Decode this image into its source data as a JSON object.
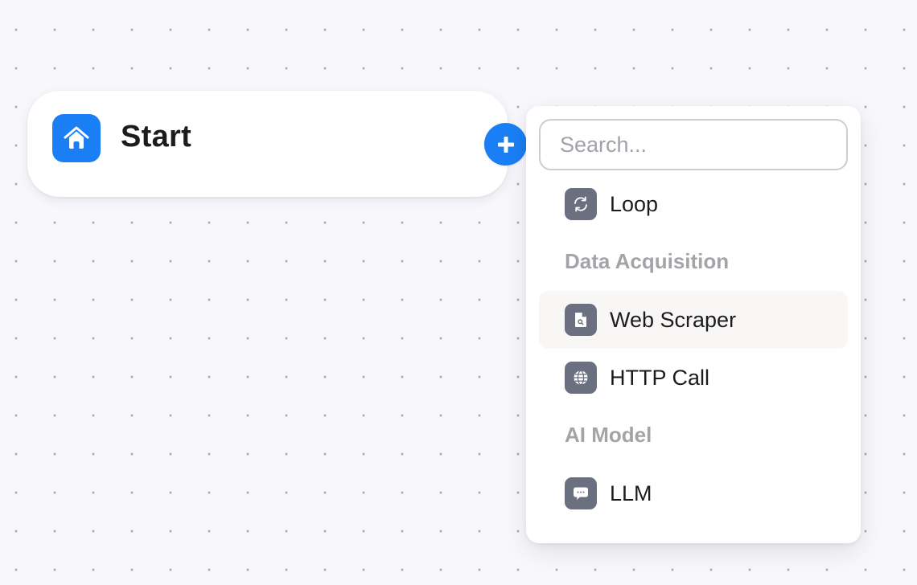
{
  "canvas": {
    "background": "#f8f8fc",
    "dot_color": "#a9a9b0"
  },
  "start_node": {
    "title": "Start",
    "icon": "home-icon",
    "accent": "#1a7ef5"
  },
  "add_button": {
    "icon": "plus-icon"
  },
  "menu": {
    "search": {
      "value": "",
      "placeholder": "Search..."
    },
    "items": [
      {
        "type": "item",
        "label": "Loop",
        "icon": "loop-icon"
      },
      {
        "type": "section",
        "label": "Data Acquisition"
      },
      {
        "type": "item",
        "label": "Web Scraper",
        "icon": "file-search-icon",
        "hovered": true
      },
      {
        "type": "item",
        "label": "HTTP Call",
        "icon": "globe-icon"
      },
      {
        "type": "section",
        "label": "AI Model"
      },
      {
        "type": "item",
        "label": "LLM",
        "icon": "chat-bubble-icon"
      }
    ],
    "icon_bg": "#6b7080",
    "section_color": "#a4a4a8",
    "hover_bg": "#f9f7f5"
  }
}
